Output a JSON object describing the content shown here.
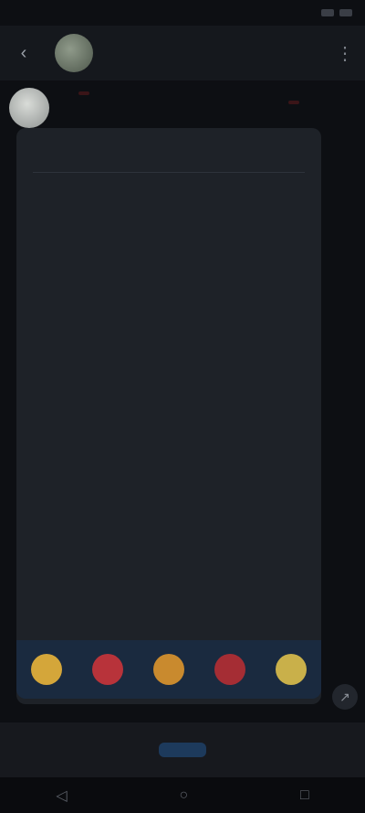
{
  "status_bar": {
    "time": "",
    "battery": ""
  },
  "header": {
    "title": "",
    "back_icon": "back-arrow-icon",
    "more_icon": "more-icon"
  },
  "message": {
    "sender_name": "",
    "badge_1": "",
    "badge_2": "",
    "paragraph_1": "",
    "paragraph_2": "",
    "option_1": "",
    "option_2": "",
    "option_3": ""
  },
  "reactions": [
    {
      "icon": "yellow-reaction",
      "color": "#d4a63a"
    },
    {
      "icon": "red-reaction",
      "color": "#b8333a"
    },
    {
      "icon": "orange-reaction",
      "color": "#c98a2e"
    },
    {
      "icon": "red-reaction",
      "color": "#a52d34"
    },
    {
      "icon": "yellow-reaction",
      "color": "#c9b04a"
    }
  ],
  "bottom": {
    "join_label": ""
  }
}
